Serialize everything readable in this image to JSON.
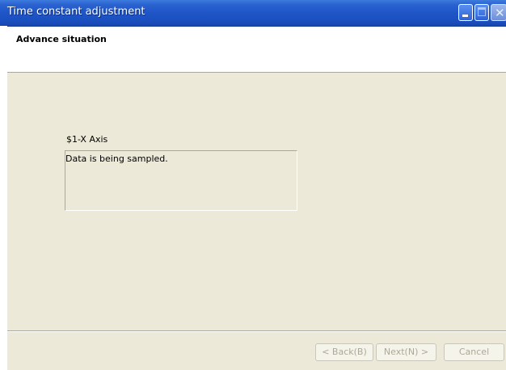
{
  "window": {
    "title": "Time constant adjustment",
    "controls": {
      "minimize": "minimize-icon",
      "maximize": "maximize-icon",
      "close": "close-icon",
      "close_glyph": "✕"
    }
  },
  "header": {
    "title": "Advance situation"
  },
  "main": {
    "axis_label": "$1-X Axis",
    "status_message": "Data is being sampled."
  },
  "footer": {
    "back_label": "< Back(B)",
    "next_label": "Next(N) >",
    "cancel_label": "Cancel"
  },
  "colors": {
    "titlebar": "#1f55c7",
    "dialog_background": "#ece9d8",
    "disabled_text": "#aca899"
  }
}
